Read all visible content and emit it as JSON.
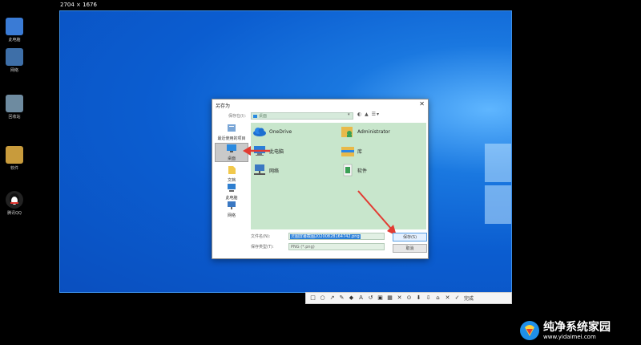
{
  "capture_size": "2704 × 1676",
  "desktop_left": [
    {
      "label": "此电脑",
      "color": "#3a7bd5"
    },
    {
      "label": "网络",
      "color": "#3e6fa8"
    },
    {
      "label": "回收站",
      "color": "#6e8ba0"
    },
    {
      "label": "软件",
      "color": "#c89b3c"
    },
    {
      "label": "腾讯QQ",
      "color": "#e0302a"
    }
  ],
  "dialog": {
    "title": "另存为",
    "close": "✕",
    "save_in_label": "保存在(I):",
    "save_in_value": "桌面",
    "tool_icons": "◐ ▲ ☰▾",
    "places": [
      {
        "label": "最近使用的项目",
        "icon": "recent-icon"
      },
      {
        "label": "桌面",
        "icon": "desktop-icon"
      },
      {
        "label": "文档",
        "icon": "documents-icon"
      },
      {
        "label": "此电脑",
        "icon": "this-pc-icon"
      },
      {
        "label": "网络",
        "icon": "network-icon"
      }
    ],
    "items": [
      {
        "label": "OneDrive",
        "icon": "cloud-icon"
      },
      {
        "label": "Administrator",
        "icon": "user-folder-icon"
      },
      {
        "label": "此电脑",
        "icon": "computer-icon"
      },
      {
        "label": "库",
        "icon": "library-icon"
      },
      {
        "label": "网络",
        "icon": "network-icon"
      },
      {
        "label": "软件",
        "icon": "software-folder-icon"
      }
    ],
    "filename_label": "文件名(N):",
    "filename_value": "灵图屏幕截图20200828164742.png",
    "filetype_label": "保存类型(T):",
    "filetype_value": "PNG (*.png)",
    "save_button": "保存(S)",
    "cancel_button": "取消"
  },
  "toolbar": {
    "tools": [
      "□",
      "○",
      "↗",
      "✎",
      "◆",
      "A",
      "↺",
      "▣",
      "▦",
      "✕",
      "⊙",
      "⬇",
      "⇩",
      "⌂",
      "✕",
      "✓"
    ],
    "done_label": "完成"
  },
  "watermark": {
    "title": "纯净系统家园",
    "url": "www.yidaimei.com"
  },
  "colors": {
    "accent": "#2a7fd8",
    "file_pane": "#c8e6cc",
    "arrow": "#e23b32"
  }
}
